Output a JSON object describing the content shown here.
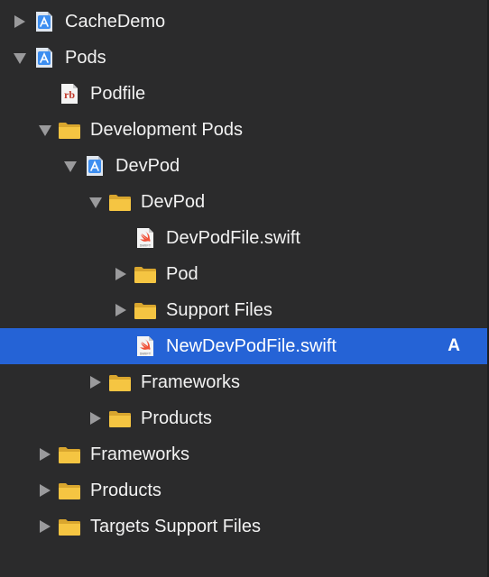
{
  "navigator": {
    "items": [
      {
        "label": "CacheDemo",
        "level": 0,
        "disclosure": "collapsed",
        "icon": "xcode-project-icon"
      },
      {
        "label": "Pods",
        "level": 0,
        "disclosure": "expanded",
        "icon": "xcode-project-icon"
      },
      {
        "label": "Podfile",
        "level": 1,
        "disclosure": "none",
        "icon": "ruby-file-icon"
      },
      {
        "label": "Development Pods",
        "level": 1,
        "disclosure": "expanded",
        "icon": "folder-icon"
      },
      {
        "label": "DevPod",
        "level": 2,
        "disclosure": "expanded",
        "icon": "xcode-project-icon"
      },
      {
        "label": "DevPod",
        "level": 3,
        "disclosure": "expanded",
        "icon": "folder-icon"
      },
      {
        "label": "DevPodFile.swift",
        "level": 4,
        "disclosure": "none",
        "icon": "swift-file-icon"
      },
      {
        "label": "Pod",
        "level": 4,
        "disclosure": "collapsed",
        "icon": "folder-icon"
      },
      {
        "label": "Support Files",
        "level": 4,
        "disclosure": "collapsed",
        "icon": "folder-icon"
      },
      {
        "label": "NewDevPodFile.swift",
        "level": 4,
        "disclosure": "none",
        "icon": "swift-file-icon",
        "selected": true,
        "badge": "A"
      },
      {
        "label": "Frameworks",
        "level": 3,
        "disclosure": "collapsed",
        "icon": "folder-icon"
      },
      {
        "label": "Products",
        "level": 3,
        "disclosure": "collapsed",
        "icon": "folder-icon"
      },
      {
        "label": "Frameworks",
        "level": 1,
        "disclosure": "collapsed",
        "icon": "folder-icon"
      },
      {
        "label": "Products",
        "level": 1,
        "disclosure": "collapsed",
        "icon": "folder-icon"
      },
      {
        "label": "Targets Support Files",
        "level": 1,
        "disclosure": "collapsed",
        "icon": "folder-icon"
      }
    ]
  },
  "colors": {
    "background": "#2b2b2c",
    "selection": "#2563d6",
    "folder": "#f5c542",
    "project": "#3d8ef0",
    "ruby": "#c0392b",
    "swift": "#f05138"
  }
}
